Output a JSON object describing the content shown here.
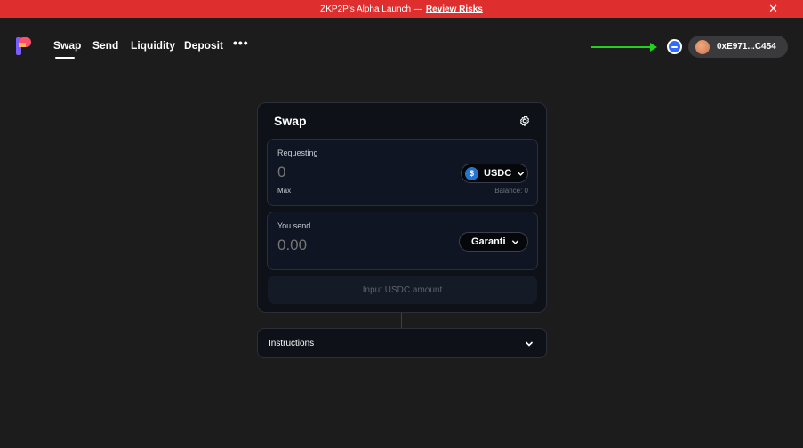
{
  "banner": {
    "text": "ZKP2P's Alpha Launch —",
    "link": "Review Risks",
    "close_glyph": "✕",
    "color": "#df2e2e"
  },
  "nav": {
    "logo": "zkp2p-logo-icon",
    "items": [
      {
        "label": "Swap",
        "active": true
      },
      {
        "label": "Send"
      },
      {
        "label": "Liquidity"
      },
      {
        "label": "Deposit"
      }
    ],
    "more_glyph": "•••"
  },
  "account": {
    "status_icon": "connected-status-icon",
    "address": "0xE971...C454"
  },
  "swap": {
    "title": "Swap",
    "settings_icon": "gear-icon",
    "requesting": {
      "label": "Requesting",
      "amount_placeholder": "0",
      "max_label": "Max",
      "balance": "Balance: 0",
      "token": "USDC",
      "token_icon_glyph": "$"
    },
    "send": {
      "label": "You send",
      "amount_placeholder": "0.00",
      "platform": "Garanti"
    },
    "action_label": "Input USDC amount"
  },
  "instructions": {
    "label": "Instructions"
  },
  "colors": {
    "accent_arrow": "#1fd31f",
    "background": "#1c1c1d",
    "card": "#0e1118"
  }
}
